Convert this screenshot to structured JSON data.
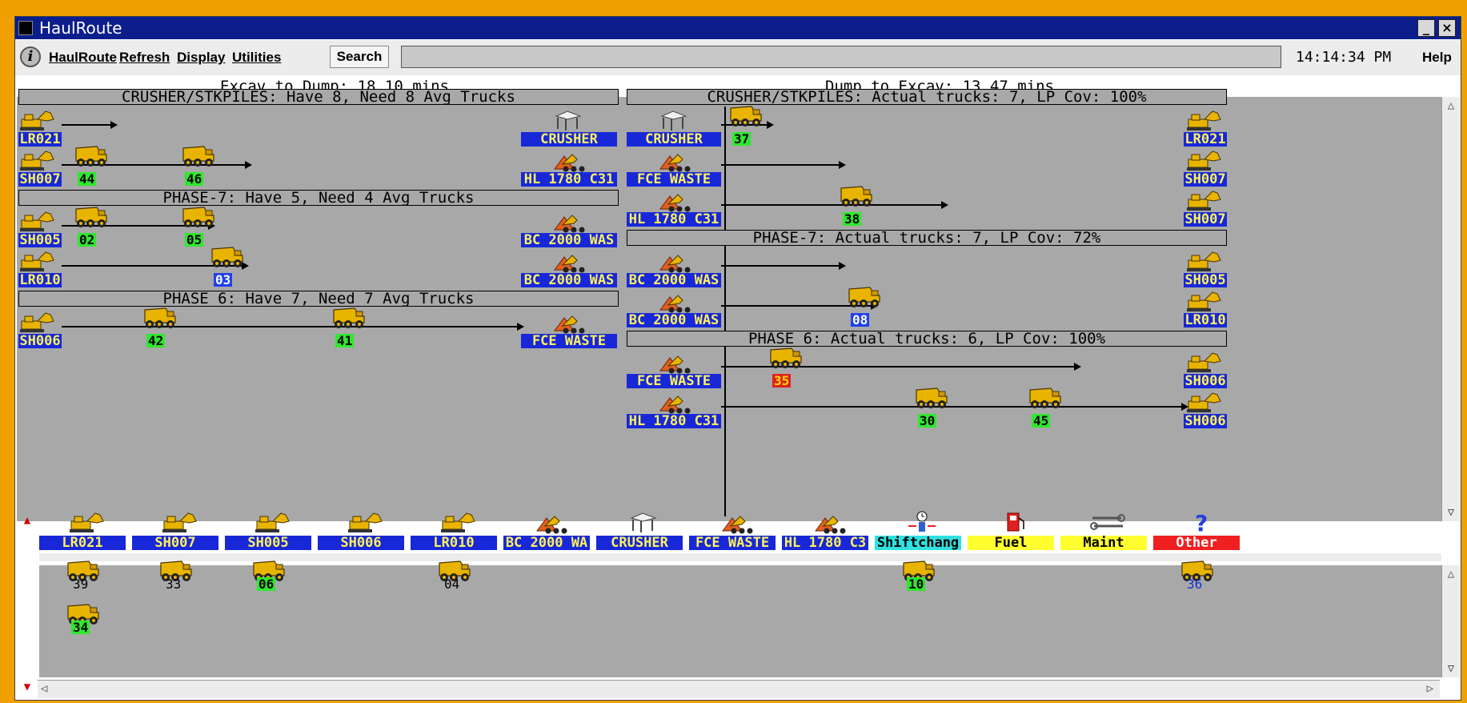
{
  "window": {
    "title": "HaulRoute"
  },
  "menu": {
    "items": [
      "HaulRoute",
      "Refresh",
      "Display",
      "Utilities"
    ],
    "search": "Search",
    "clock": "14:14:34 PM",
    "help": "Help"
  },
  "headers": {
    "left": "Excav to Dump: 18.10 mins",
    "right": "Dump to Excav: 13.47 mins"
  },
  "left_sections": [
    "CRUSHER/STKPILES: Have 8, Need 8 Avg Trucks",
    "PHASE-7: Have 5, Need 4 Avg Trucks",
    "PHASE 6: Have 7, Need 7 Avg Trucks"
  ],
  "right_sections": [
    "CRUSHER/STKPILES: Actual trucks: 7, LP Cov: 100%",
    "PHASE-7: Actual trucks: 7, LP Cov: 72%",
    "PHASE 6: Actual trucks: 6, LP Cov: 100%"
  ],
  "left_rows": [
    {
      "src": "LR021",
      "dst": "CRUSHER",
      "trucks": []
    },
    {
      "src": "SH007",
      "dst": "HL 1780 C31",
      "trucks": [
        "44",
        "46"
      ]
    },
    {
      "src": "SH005",
      "dst": "BC 2000 WAS",
      "trucks": [
        "02",
        "05"
      ]
    },
    {
      "src": "LR010",
      "dst": "BC 2000 WAS",
      "trucks": [
        "03"
      ]
    },
    {
      "src": "SH006",
      "dst": "FCE WASTE",
      "trucks": [
        "42",
        "41"
      ]
    }
  ],
  "right_rows": [
    {
      "src": "CRUSHER",
      "dst": "LR021",
      "trucks": [
        "37"
      ]
    },
    {
      "src": "FCE WASTE",
      "dst": "SH007",
      "trucks": []
    },
    {
      "src": "HL 1780 C31",
      "dst": "SH007",
      "trucks": [
        "38"
      ]
    },
    {
      "src": "BC 2000 WAS",
      "dst": "SH005",
      "trucks": []
    },
    {
      "src": "BC 2000 WAS",
      "dst": "LR010",
      "trucks": [
        "08"
      ]
    },
    {
      "src": "FCE WASTE",
      "dst": "SH006",
      "trucks": [
        "35"
      ]
    },
    {
      "src": "HL 1780 C31",
      "dst": "SH006",
      "trucks": [
        "30",
        "45"
      ]
    }
  ],
  "categories": [
    {
      "label": "LR021",
      "icon": "shovel-icon"
    },
    {
      "label": "SH007",
      "icon": "shovel-icon"
    },
    {
      "label": "SH005",
      "icon": "shovel-icon"
    },
    {
      "label": "SH006",
      "icon": "shovel-icon"
    },
    {
      "label": "LR010",
      "icon": "shovel-icon"
    },
    {
      "label": "BC 2000 WA",
      "icon": "dump-icon"
    },
    {
      "label": "CRUSHER",
      "icon": "crusher-icon"
    },
    {
      "label": "FCE WASTE",
      "icon": "dump-icon"
    },
    {
      "label": "HL 1780 C3",
      "icon": "dump-icon"
    },
    {
      "label": "Shiftchang",
      "icon": "shiftchange-icon"
    },
    {
      "label": "Fuel",
      "icon": "fuel-icon"
    },
    {
      "label": "Maint",
      "icon": "wrench-icon"
    },
    {
      "label": "Other",
      "icon": "question-icon"
    }
  ],
  "pool": [
    "39",
    "33",
    "06",
    "04",
    "10",
    "36",
    "34"
  ],
  "colors": {
    "title_bar": "#0b1e8c",
    "location_bg": "#1828d8",
    "location_text": "#fff25a",
    "truck_green": "#2ee82e",
    "truck_red": "#e02020",
    "shiftchange": "#30e0e0",
    "fuel": "#ffff30",
    "maint": "#ffff30",
    "other": "#f02020"
  }
}
